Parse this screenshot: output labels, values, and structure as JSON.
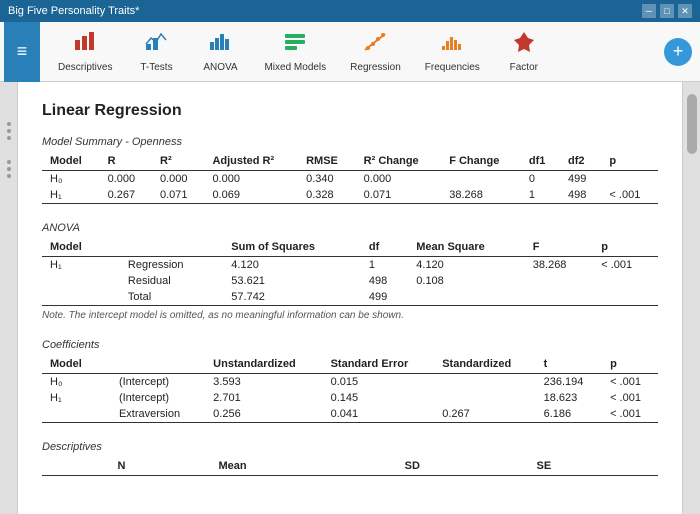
{
  "titleBar": {
    "title": "Big Five Personality Traits*",
    "controls": [
      "minimize",
      "maximize",
      "close"
    ]
  },
  "toolbar": {
    "hamburger": "≡",
    "items": [
      {
        "id": "descriptives",
        "label": "Descriptives",
        "icon": "📊",
        "color": "red"
      },
      {
        "id": "t-tests",
        "label": "T-Tests",
        "icon": "📉",
        "color": "blue"
      },
      {
        "id": "anova",
        "label": "ANOVA",
        "icon": "📈",
        "color": "blue"
      },
      {
        "id": "mixed-models",
        "label": "Mixed Models",
        "icon": "📋",
        "color": "green"
      },
      {
        "id": "regression",
        "label": "Regression",
        "icon": "📉",
        "color": "orange"
      },
      {
        "id": "frequencies",
        "label": "Frequencies",
        "icon": "📊",
        "color": "orange"
      },
      {
        "id": "factor",
        "label": "Factor",
        "icon": "🔷",
        "color": "red"
      }
    ],
    "addButton": "+"
  },
  "content": {
    "pageTitle": "Linear Regression",
    "modelSummary": {
      "title": "Model Summary - Openness",
      "columns": [
        "Model",
        "R",
        "R²",
        "Adjusted R²",
        "RMSE",
        "R² Change",
        "F Change",
        "df1",
        "df2",
        "p"
      ],
      "rows": [
        [
          "H₀",
          "0.000",
          "0.000",
          "0.000",
          "0.340",
          "0.000",
          "",
          "0",
          "499",
          ""
        ],
        [
          "H₁",
          "0.267",
          "0.071",
          "0.069",
          "0.328",
          "0.071",
          "38.268",
          "1",
          "498",
          "< .001"
        ]
      ]
    },
    "anova": {
      "title": "ANOVA",
      "columns": [
        "Model",
        "",
        "Sum of Squares",
        "df",
        "Mean Square",
        "F",
        "p"
      ],
      "rows": [
        [
          "H₁",
          "Regression",
          "4.120",
          "1",
          "4.120",
          "38.268",
          "< .001"
        ],
        [
          "",
          "Residual",
          "53.621",
          "498",
          "0.108",
          "",
          ""
        ],
        [
          "",
          "Total",
          "57.742",
          "499",
          "",
          "",
          ""
        ]
      ],
      "note": "Note. The intercept model is omitted, as no meaningful information can be shown."
    },
    "coefficients": {
      "title": "Coefficients",
      "columns": [
        "Model",
        "",
        "Unstandardized",
        "Standard Error",
        "Standardized",
        "t",
        "p"
      ],
      "rows": [
        [
          "H₀",
          "(Intercept)",
          "3.593",
          "0.015",
          "",
          "236.194",
          "< .001"
        ],
        [
          "H₁",
          "(Intercept)",
          "2.701",
          "0.145",
          "",
          "18.623",
          "< .001"
        ],
        [
          "",
          "Extraversion",
          "0.256",
          "0.041",
          "0.267",
          "6.186",
          "< .001"
        ]
      ]
    },
    "descriptives": {
      "title": "Descriptives",
      "columns": [
        "",
        "N",
        "Mean",
        "SD",
        "SE"
      ]
    }
  }
}
